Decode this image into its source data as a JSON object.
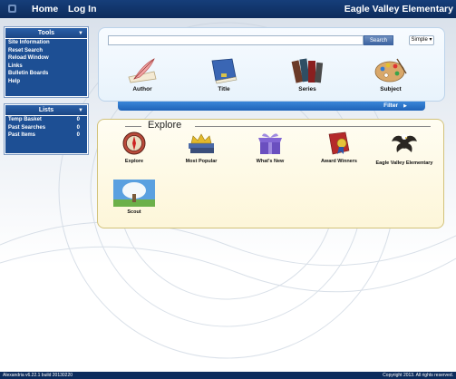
{
  "topbar": {
    "home_label": "Home",
    "login_label": "Log In",
    "site_title": "Eagle Valley Elementary"
  },
  "tools": {
    "title": "Tools",
    "items": [
      {
        "label": "Site Information"
      },
      {
        "label": "Reset Search"
      },
      {
        "label": "Reload Window"
      },
      {
        "label": "Links"
      },
      {
        "label": "Bulletin Boards"
      },
      {
        "label": "Help"
      }
    ]
  },
  "lists": {
    "title": "Lists",
    "items": [
      {
        "label": "Temp Basket",
        "count": "0"
      },
      {
        "label": "Past Searches",
        "count": "0"
      },
      {
        "label": "Past Items",
        "count": "0"
      }
    ]
  },
  "search": {
    "input_value": "",
    "button_label": "Search",
    "mode_label": "Simple",
    "categories": [
      {
        "label": "Author",
        "icon": "quill-pen-icon"
      },
      {
        "label": "Title",
        "icon": "book-icon"
      },
      {
        "label": "Series",
        "icon": "books-stack-icon"
      },
      {
        "label": "Subject",
        "icon": "palette-icon"
      }
    ],
    "filter_label": "Filter"
  },
  "explore": {
    "title": "Explore",
    "items": [
      {
        "label": "Explore",
        "icon": "compass-icon"
      },
      {
        "label": "Most Popular",
        "icon": "crown-books-icon"
      },
      {
        "label": "What's New",
        "icon": "new-gift-icon"
      },
      {
        "label": "Award Winners",
        "icon": "award-ribbon-icon"
      },
      {
        "label": "Eagle Valley Elementary",
        "icon": "eagle-icon"
      },
      {
        "label": "Scout",
        "icon": "tree-icon"
      }
    ]
  },
  "footer": {
    "version": "Alexandria v6.22.1 build 20130220",
    "copyright": "Copyright 2013. All rights reserved."
  },
  "colors": {
    "topbar": "#0d2c5c",
    "sidebar": "#1d4f94",
    "filter_bar": "#2a74c8",
    "explore_bg": "#fdf6d9"
  }
}
